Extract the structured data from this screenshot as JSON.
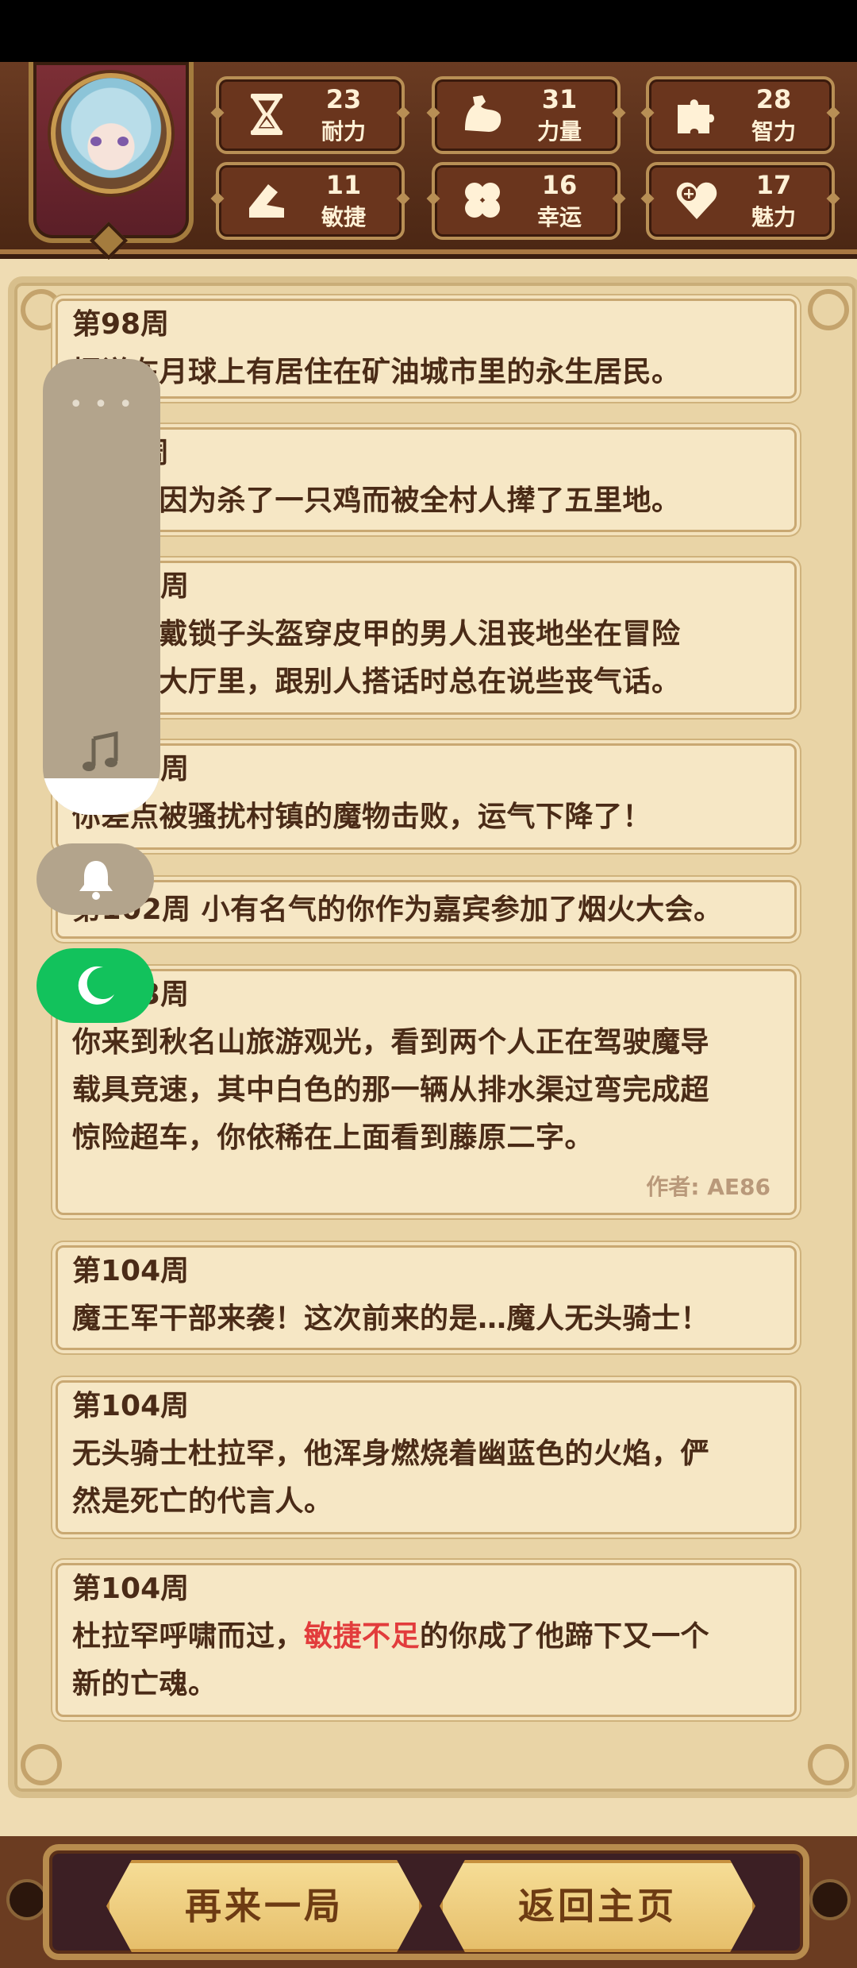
{
  "stats": [
    {
      "icon": "hourglass-icon",
      "value": "23",
      "label": "耐力"
    },
    {
      "icon": "muscle-arm-icon",
      "value": "31",
      "label": "力量"
    },
    {
      "icon": "puzzle-piece-icon",
      "value": "28",
      "label": "智力"
    },
    {
      "icon": "boot-icon",
      "value": "11",
      "label": "敏捷"
    },
    {
      "icon": "clover-icon",
      "value": "16",
      "label": "幸运"
    },
    {
      "icon": "heart-plus-icon",
      "value": "17",
      "label": "魅力"
    }
  ],
  "events": [
    {
      "week": "第98周",
      "text": "据说在月球上有居住在矿油城市里的永生居民。"
    },
    {
      "week": "第99周",
      "text": "有个人因为杀了一只鸡而被全村人撵了五里地。"
    },
    {
      "week": "第100周",
      "line1": "有一个戴锁子头盔穿皮甲的男人沮丧地坐在冒险",
      "line2": "者协会大厅里，跟别人搭话时总在说些丧气话。"
    },
    {
      "week": "第101周",
      "text": "你差点被骚扰村镇的魔物击败，运气下降了！"
    },
    {
      "inline": "第102周 小有名气的你作为嘉宾参加了烟火大会。"
    },
    {
      "week": "第103周",
      "line1": "你来到秋名山旅游观光，看到两个人正在驾驶魔导",
      "line2": "载具竞速，其中白色的那一辆从排水渠过弯完成超",
      "line3": "惊险超车，你依稀在上面看到藤原二字。",
      "author": "作者: AE86"
    },
    {
      "week": "第104周",
      "text": "魔王军干部来袭！这次前来的是…魔人无头骑士！"
    },
    {
      "week": "第104周",
      "line1": "无头骑士杜拉罕，他浑身燃烧着幽蓝色的火焰，俨",
      "line2": "然是死亡的代言人。"
    },
    {
      "week": "第104周",
      "pre": "杜拉罕呼啸而过，",
      "highlight": "敏捷不足",
      "post": "的你成了他蹄下又一个",
      "line2": "新的亡魂。"
    }
  ],
  "buttons": {
    "replay": "再来一局",
    "home": "返回主页"
  },
  "colors": {
    "header": "#5a2f18",
    "card": "#f6e7c5",
    "text": "#4a2b17",
    "highlight": "#e23c3c",
    "moon": "#12c25c"
  }
}
